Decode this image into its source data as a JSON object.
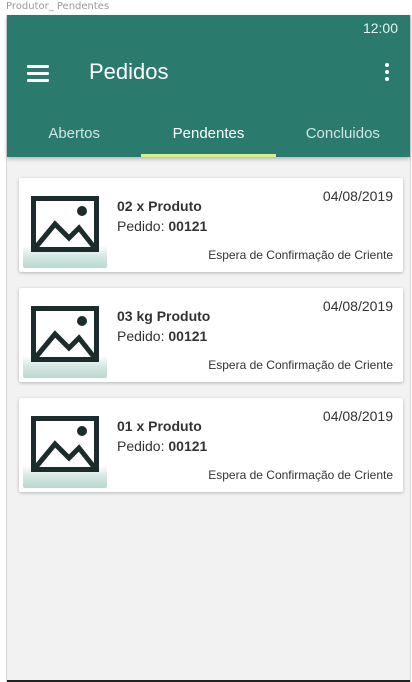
{
  "artboard_title": "Produtor_ Pendentes",
  "status_bar": {
    "time": "12:00"
  },
  "app_bar": {
    "title": "Pedidos"
  },
  "tabs": [
    {
      "label": "Abertos",
      "active": false
    },
    {
      "label": "Pendentes",
      "active": true
    },
    {
      "label": "Concluidos",
      "active": false
    }
  ],
  "colors": {
    "primary": "#2b7a6e",
    "tab_indicator": "#d4f08a",
    "card_bg": "#ffffff",
    "page_bg": "#f2f2f2"
  },
  "orders": [
    {
      "thumb_icon": "image-placeholder-icon",
      "product": "02 x Produto",
      "order_label": "Pedido:",
      "order_number": "00121",
      "date": "04/08/2019",
      "status": "Espera de Confirmação de Criente"
    },
    {
      "thumb_icon": "image-placeholder-icon",
      "product": "03 kg Produto",
      "order_label": "Pedido:",
      "order_number": "00121",
      "date": "04/08/2019",
      "status": "Espera de Confirmação de Criente"
    },
    {
      "thumb_icon": "image-placeholder-icon",
      "product": "01 x Produto",
      "order_label": "Pedido:",
      "order_number": "00121",
      "date": "04/08/2019",
      "status": "Espera de Confirmação de Criente"
    }
  ]
}
